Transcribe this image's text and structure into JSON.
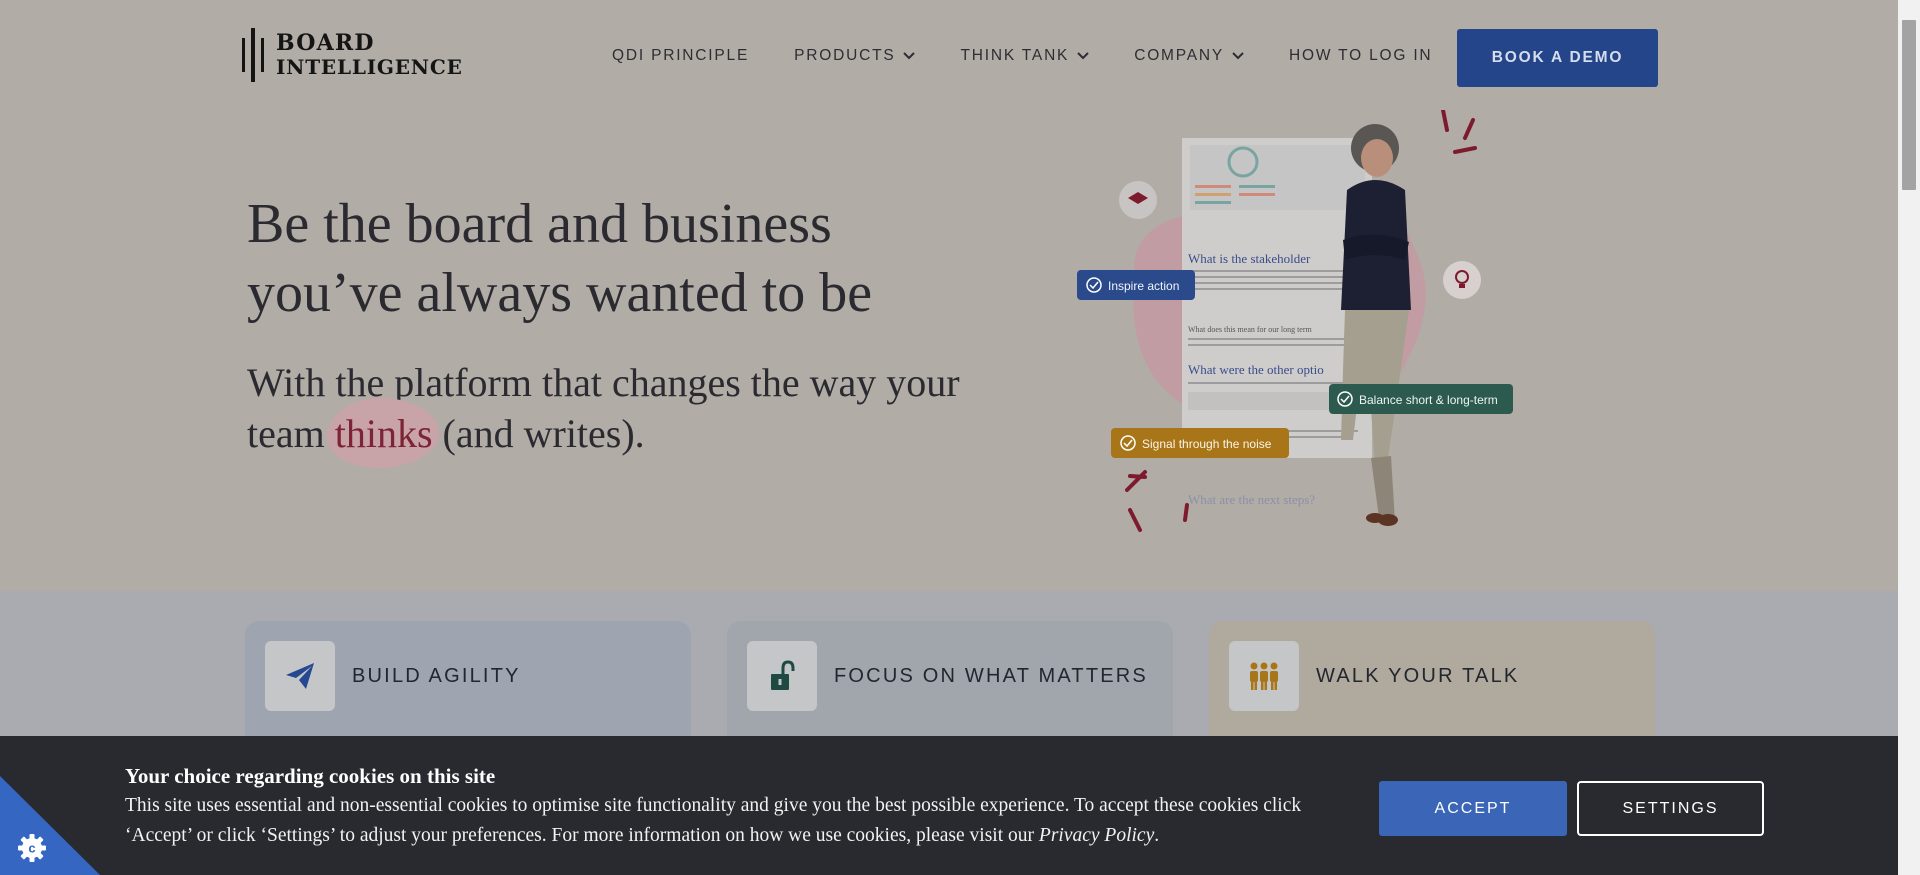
{
  "brand": {
    "line1": "BOARD",
    "line2": "INTELLIGENCE"
  },
  "nav": {
    "items": [
      {
        "label": "QDI PRINCIPLE",
        "has_dropdown": false
      },
      {
        "label": "PRODUCTS",
        "has_dropdown": true
      },
      {
        "label": "THINK TANK",
        "has_dropdown": true
      },
      {
        "label": "COMPANY",
        "has_dropdown": true
      },
      {
        "label": "HOW TO LOG IN",
        "has_dropdown": false
      }
    ],
    "cta": "BOOK A DEMO"
  },
  "hero": {
    "title": "Be the board and business you’ve always wanted to be",
    "subtitle_before": "With the platform that changes the way your team ",
    "subtitle_highlight": "thinks",
    "subtitle_after": " (and writes).",
    "badges": {
      "inspire": "Inspire action",
      "balance": "Balance short & long-term",
      "signal": "Signal through the noise"
    },
    "document_headings": [
      "What is the stakeholder",
      "What does this mean for our long term",
      "What were the other optio",
      "What are the next steps?"
    ]
  },
  "features": [
    {
      "title": "BUILD AGILITY",
      "body": "...",
      "icon": "paper-plane-icon"
    },
    {
      "title": "FOCUS ON WHAT MATTERS",
      "body": "...",
      "icon": "unlock-icon"
    },
    {
      "title": "WALK YOUR TALK",
      "body": "...",
      "icon": "people-icon"
    }
  ],
  "cookie": {
    "title": "Your choice regarding cookies on this site",
    "text_before": "This site uses essential and non-essential cookies to optimise site functionality and give you the best possible experience. To accept these cookies click ‘Accept’ or click ‘Settings’ to adjust your preferences. For more information on how we use cookies, please visit our ",
    "privacy_link": "Privacy Policy",
    "text_after": ".",
    "accept": "ACCEPT",
    "settings": "SETTINGS"
  },
  "colors": {
    "brand_blue": "#24458a",
    "accept_blue": "#3b66b8",
    "highlight_red": "#7c2435",
    "badge_blue": "#2a4a8c",
    "badge_green": "#2c5a4e",
    "badge_orange": "#a87618",
    "banner_dark": "#282a2f"
  }
}
